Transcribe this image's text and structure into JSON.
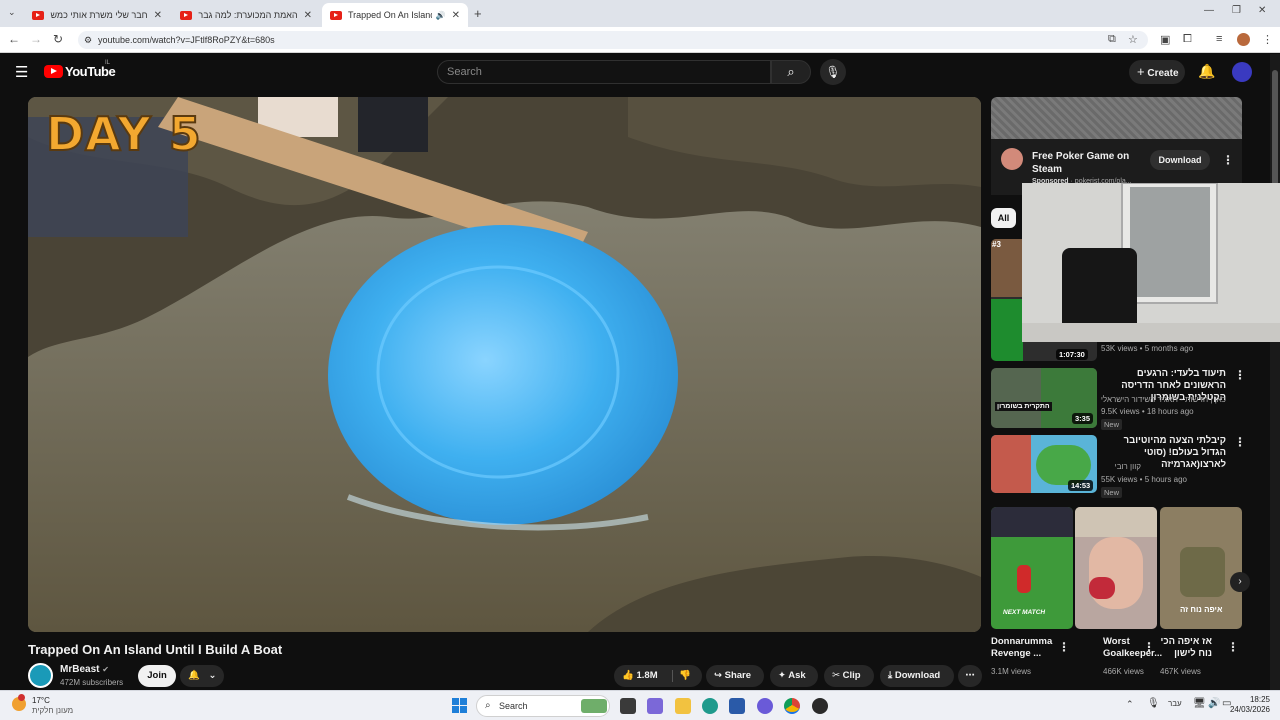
{
  "browser": {
    "tabs": [
      {
        "title": "חבר שלי משרת אותי כמשך יום"
      },
      {
        "title": "האמת המכוערת: למה גברים מ"
      },
      {
        "title": "Trapped On An Island Until"
      }
    ],
    "url": "youtube.com/watch?v=JFtlf8RoPZY&t=680s"
  },
  "header": {
    "logo": "YouTube",
    "region": "IL",
    "search_placeholder": "Search",
    "create_label": "Create"
  },
  "video": {
    "overlay_text": "DAY 5",
    "title": "Trapped On An Island Until I Build A Boat",
    "channel": "MrBeast",
    "subscribers": "472M subscribers",
    "join_label": "Join",
    "likes": "1.8M",
    "share_label": "Share",
    "ask_label": "Ask",
    "clip_label": "Clip",
    "download_label": "Download"
  },
  "ad": {
    "title": "Free Poker Game on Steam",
    "sponsored": "Sponsored",
    "domain": "pokerist.com/pla...",
    "button": "Download"
  },
  "filter_chip": "All",
  "recommendations": [
    {
      "badge": "#3",
      "duration": "1:07:30",
      "meta": "53K views • 5 months ago"
    },
    {
      "title": "תיעוד בלעדי: הרגעים הראשונים לאחר הדריסה הקטלנית בשומרון",
      "channel": "כאן | חדשות - תאגיד השידור הישראלי",
      "meta": "9.5K views • 18 hours ago",
      "new": "New",
      "duration": "3:35",
      "thumb_text": "התקרית בשומרון"
    },
    {
      "title": "קיבלתי הצעה מהיוטיובר הגדול בעולם! (סוטי לארצו(אגרמיזה",
      "channel": "קוון רובי",
      "meta": "55K views • 5 hours ago",
      "new": "New",
      "duration": "14:53"
    }
  ],
  "shorts": [
    {
      "title": "Donnarumma Revenge ...",
      "views": "3.1M views",
      "thumb_text": "NEXT MATCH"
    },
    {
      "title": "Worst Goalkeeper...",
      "views": "466K views"
    },
    {
      "title": "אז איפה הכי נוח לישון",
      "views": "467K views",
      "thumb_text": "איפה נוח זה"
    }
  ],
  "taskbar": {
    "weather_temp": "17°C",
    "weather_desc": "מעונן חלקית",
    "search_label": "Search",
    "lang": "עבר",
    "time": "18:25",
    "date": "24/03/2026"
  },
  "colors": {
    "yt_red": "#ff0000",
    "background": "#0f0f0f",
    "plate_blue": "#3fb0f0"
  }
}
